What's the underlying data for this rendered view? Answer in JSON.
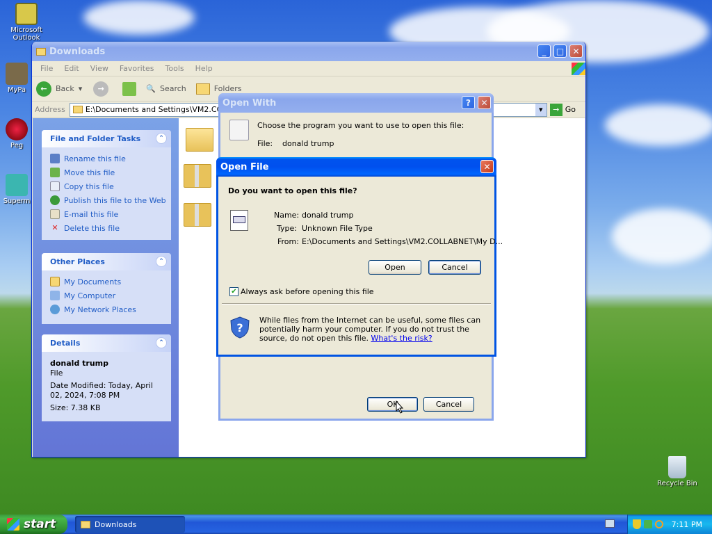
{
  "desktop": {
    "icons": [
      {
        "label": "Microsoft Outlook"
      },
      {
        "label": "MyPa"
      },
      {
        "label": "Peg"
      },
      {
        "label": "Superm"
      },
      {
        "label": "Recycle Bin"
      }
    ]
  },
  "explorer": {
    "title": "Downloads",
    "menu": [
      "File",
      "Edit",
      "View",
      "Favorites",
      "Tools",
      "Help"
    ],
    "toolbar": {
      "back": "Back",
      "search": "Search",
      "folders": "Folders"
    },
    "address": {
      "label": "Address",
      "value": "E:\\Documents and Settings\\VM2.COLLAB",
      "go": "Go"
    },
    "file_tasks": {
      "title": "File and Folder Tasks",
      "items": [
        "Rename this file",
        "Move this file",
        "Copy this file",
        "Publish this file to the Web",
        "E-mail this file",
        "Delete this file"
      ]
    },
    "other_places": {
      "title": "Other Places",
      "items": [
        "My Documents",
        "My Computer",
        "My Network Places"
      ]
    },
    "details": {
      "title": "Details",
      "name": "donald trump",
      "type": "File",
      "modified": "Date Modified: Today, April 02, 2024, 7:08 PM",
      "size": "Size: 7.38 KB"
    }
  },
  "open_with": {
    "title": "Open With",
    "prompt": "Choose the program you want to use to open this file:",
    "file_label": "File:",
    "file_value": "donald trump",
    "ok": "OK",
    "cancel": "Cancel"
  },
  "open_file": {
    "title": "Open File",
    "question": "Do you want to open this file?",
    "name_label": "Name:",
    "name_value": "donald trump",
    "type_label": "Type:",
    "type_value": "Unknown File Type",
    "from_label": "From:",
    "from_value": "E:\\Documents and Settings\\VM2.COLLABNET\\My D...",
    "open": "Open",
    "cancel": "Cancel",
    "checkbox_label": "Always ask before opening this file",
    "checkbox_checked": true,
    "warning": "While files from the Internet can be useful, some files can potentially harm your computer. If you do not trust the source, do not open this file.",
    "risk_link": "What's the risk?"
  },
  "taskbar": {
    "start": "start",
    "task": "Downloads",
    "clock": "7:11 PM"
  }
}
